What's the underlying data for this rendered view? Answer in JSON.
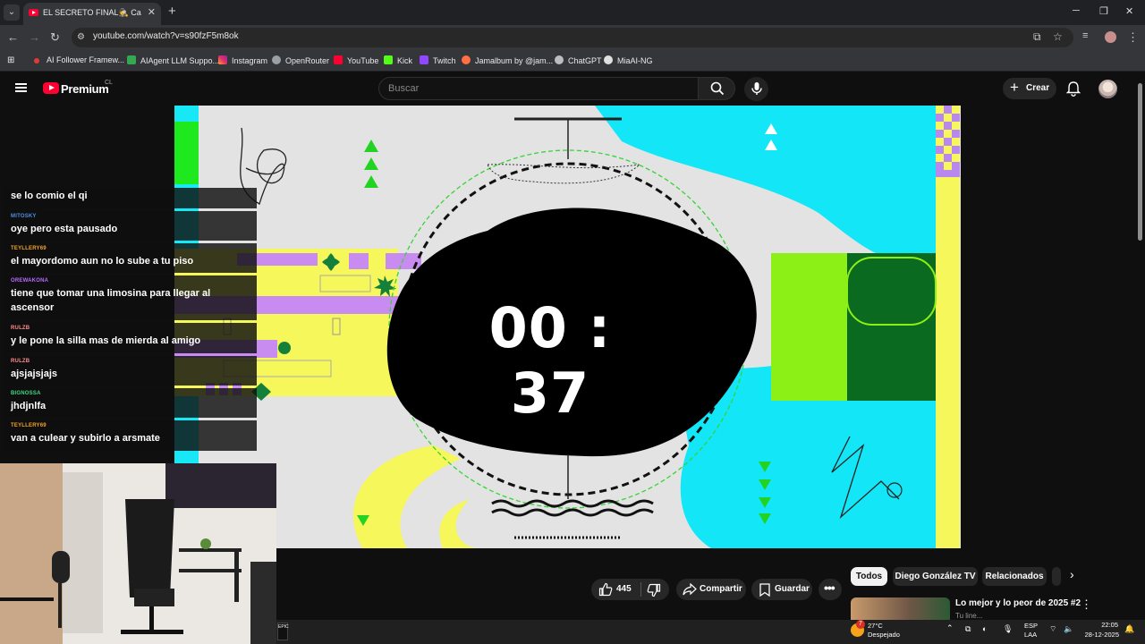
{
  "browser": {
    "tab_title": "EL SECRETO FINAL🕵️ Capítulo",
    "url": "youtube.com/watch?v=s90fzF5m8ok",
    "bookmarks": [
      {
        "label": "AI Follower Framew...",
        "color": "#e53935"
      },
      {
        "label": "AIAgent LLM Suppo...",
        "color": "#34a853"
      },
      {
        "label": "Instagram",
        "color": "#e1306c"
      },
      {
        "label": "OpenRouter",
        "color": "#9aa0a6"
      },
      {
        "label": "YouTube",
        "color": "#ff0033"
      },
      {
        "label": "Kick",
        "color": "#53fc18"
      },
      {
        "label": "Twitch",
        "color": "#9146ff"
      },
      {
        "label": "Jamalbum by @jam...",
        "color": "#ff7043"
      },
      {
        "label": "ChatGPT",
        "color": "#bdbdbd"
      },
      {
        "label": "MiaAI-NG",
        "color": "#e0e0e0"
      }
    ]
  },
  "youtube": {
    "brand": "Premium",
    "country_code": "CL",
    "search_placeholder": "Buscar",
    "create_label": "Crear",
    "likes": "445",
    "share_label": "Compartir",
    "save_label": "Guardar",
    "chips": [
      "Todos",
      "Diego González TV",
      "Relacionados"
    ],
    "suggested_title": "Lo mejor y lo peor de 2025 #2",
    "suggested_channel": "Tu line..."
  },
  "video": {
    "timer": "00 : 37"
  },
  "chat": [
    {
      "user": "",
      "text": "se lo comio el qi",
      "color": "#ffffff"
    },
    {
      "user": "MITOSKY",
      "text": "oye pero esta pausado",
      "color": "#4a90e2"
    },
    {
      "user": "TEYLLERY69",
      "text": "el mayordomo aun no lo sube a tu piso",
      "color": "#f5a623"
    },
    {
      "user": "OREWAKONA",
      "text": "tiene que tomar una limosina para llegar al ascensor",
      "color": "#b86bff"
    },
    {
      "user": "RULZB",
      "text": "y le pone la silla mas de mierda al amigo",
      "color": "#ff8c8c"
    },
    {
      "user": "RULZB",
      "text": "ajsjajsjajs",
      "color": "#ff8c8c"
    },
    {
      "user": "BIGNOSSA",
      "text": "jhdjnlfa",
      "color": "#3ddc84"
    },
    {
      "user": "TEYLLERY69",
      "text": "van a culear y subirlo a arsmate",
      "color": "#f5a623"
    }
  ],
  "taskbar": {
    "temperature": "27°C",
    "weather": "Despejado",
    "lang_top": "ESP",
    "lang_bottom": "LAA",
    "time": "22:05",
    "date": "28-12-2025",
    "weather_badge": "7"
  }
}
